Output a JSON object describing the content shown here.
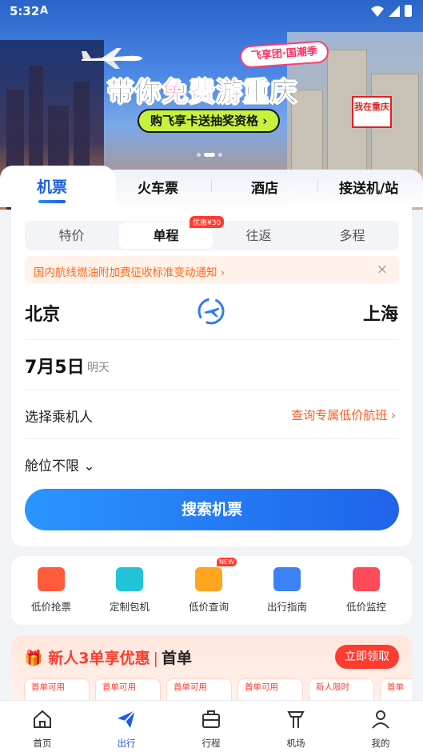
{
  "status_bar": {
    "time": "5:32"
  },
  "banner": {
    "tag": "飞享团·国潮季",
    "slogan_pre": "带你",
    "slogan_hl": "免费",
    "slogan_post": "游重庆",
    "cta": "购飞享卡送抽奖资格 ›",
    "sign_text": "我在重庆"
  },
  "tabs": [
    {
      "label": "机票",
      "active": true
    },
    {
      "label": "火车票"
    },
    {
      "label": "酒店"
    },
    {
      "label": "接送机/站"
    }
  ],
  "trip_types": [
    {
      "label": "特价"
    },
    {
      "label": "单程",
      "active": true,
      "badge": "优惠¥30"
    },
    {
      "label": "往返"
    },
    {
      "label": "多程"
    }
  ],
  "notice": {
    "text": "国内航线燃油附加费征收标准变动通知 ›",
    "close": "×"
  },
  "route": {
    "from": "北京",
    "to": "上海"
  },
  "date": {
    "value": "7月5日",
    "sub": "明天"
  },
  "passenger": {
    "label": "选择乘机人",
    "link": "查询专属低价航班 ›"
  },
  "cabin": {
    "label": "舱位不限 ⌄"
  },
  "search_button": "搜索机票",
  "tools": [
    {
      "label": "低价抢票",
      "color": "#ff5a3a"
    },
    {
      "label": "定制包机",
      "color": "#22c3d8"
    },
    {
      "label": "低价查询",
      "color": "#ffa51f",
      "badge": "NEW"
    },
    {
      "label": "出行指南",
      "color": "#3b82f6"
    },
    {
      "label": "低价监控",
      "color": "#ff4a5a"
    }
  ],
  "new_user": {
    "title": "新人3单享优惠",
    "sep": "|",
    "first": "首单",
    "button": "立即领取",
    "coupons": [
      "首单可用",
      "首单可用",
      "首单可用",
      "首单可用",
      "新人限时",
      "首单"
    ]
  },
  "bottom_nav": [
    {
      "label": "首页"
    },
    {
      "label": "出行",
      "active": true
    },
    {
      "label": "行程"
    },
    {
      "label": "机场"
    },
    {
      "label": "我的"
    }
  ]
}
